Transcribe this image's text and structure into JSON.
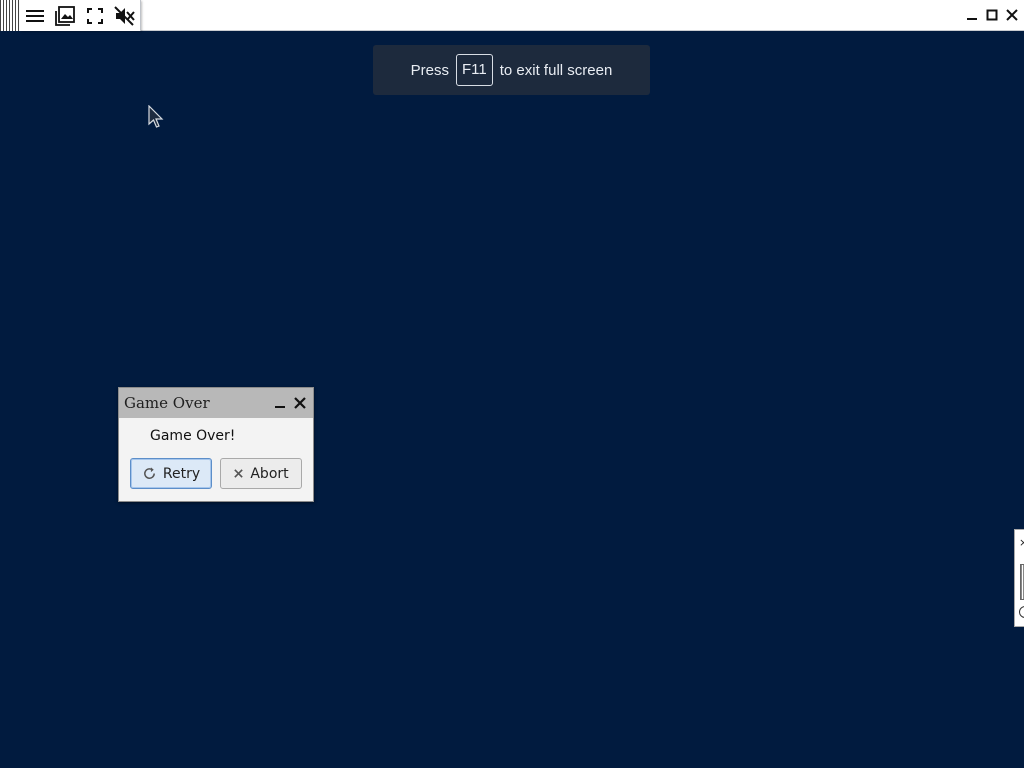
{
  "toolbar": {
    "icons": [
      "menu-icon",
      "gallery-icon",
      "fullscreen-icon",
      "mute-icon"
    ]
  },
  "window_controls": [
    "minimize-icon",
    "maximize-icon",
    "close-icon"
  ],
  "fullscreen_banner": {
    "press": "Press",
    "key": "F11",
    "rest": "to exit full screen"
  },
  "dialog": {
    "title": "Game Over",
    "message": "Game Over!",
    "retry_label": "Retry",
    "abort_label": "Abort"
  },
  "edge_widget": {
    "close_glyph": "×"
  },
  "colors": {
    "background": "#011b3f",
    "banner": "#1d2a3d",
    "dialog_title": "#b8b8b8",
    "retry_focus": "#5c8ec9"
  }
}
